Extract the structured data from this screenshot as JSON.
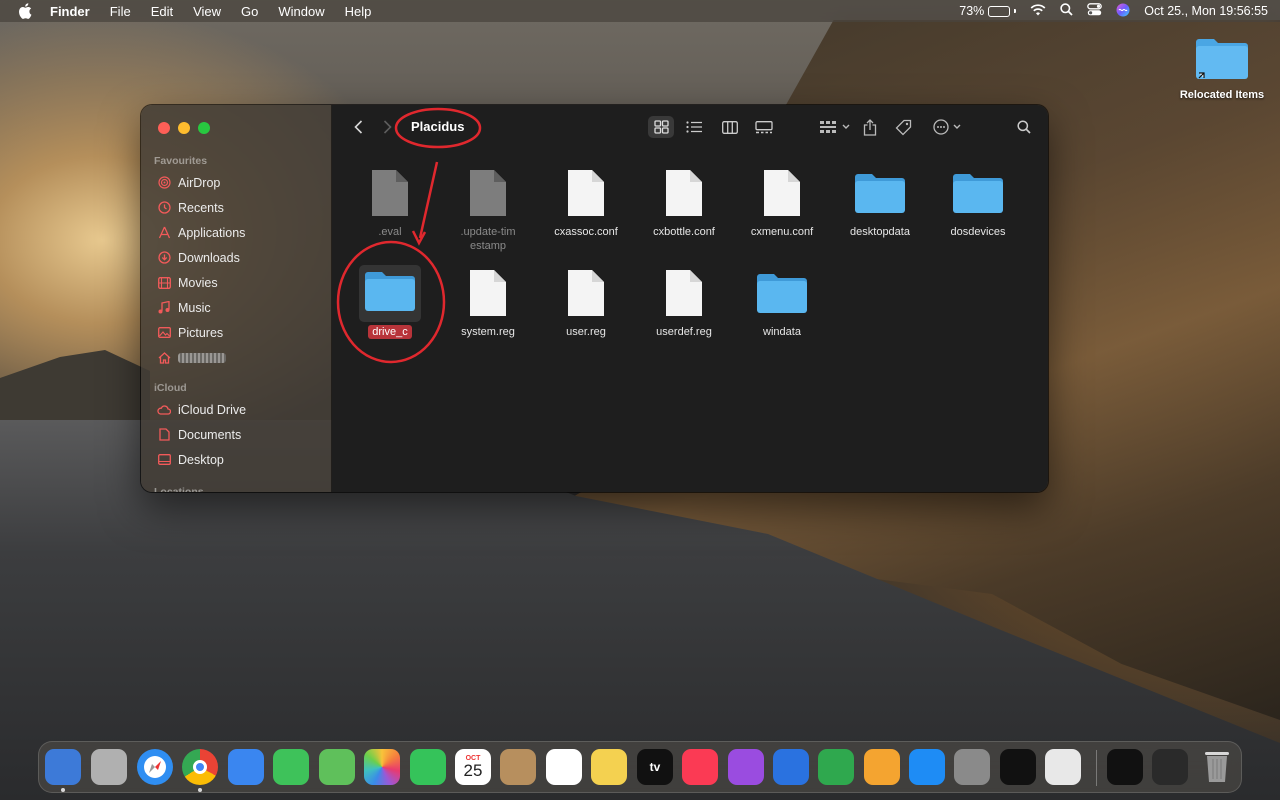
{
  "menubar": {
    "app_name": "Finder",
    "menus": [
      "File",
      "Edit",
      "View",
      "Go",
      "Window",
      "Help"
    ],
    "battery_percent": "73%",
    "battery_level": 0.73,
    "datetime": "Oct 25., Mon  19:56:55"
  },
  "desktop": {
    "items": [
      {
        "label": "Relocated Items",
        "icon": "folder-alias-icon"
      }
    ]
  },
  "window": {
    "title": "Placidus",
    "sidebar": {
      "favourites_heading": "Favourites",
      "favourites": [
        {
          "label": "AirDrop",
          "icon": "airdrop-icon"
        },
        {
          "label": "Recents",
          "icon": "clock-icon"
        },
        {
          "label": "Applications",
          "icon": "applications-icon"
        },
        {
          "label": "Downloads",
          "icon": "download-icon"
        },
        {
          "label": "Movies",
          "icon": "film-icon"
        },
        {
          "label": "Music",
          "icon": "music-note-icon"
        },
        {
          "label": "Pictures",
          "icon": "photo-icon"
        },
        {
          "label": "",
          "icon": "home-icon"
        }
      ],
      "icloud_heading": "iCloud",
      "icloud": [
        {
          "label": "iCloud Drive",
          "icon": "cloud-icon"
        },
        {
          "label": "Documents",
          "icon": "document-icon"
        },
        {
          "label": "Desktop",
          "icon": "desktop-icon"
        }
      ],
      "locations_heading": "Locations"
    },
    "files": [
      {
        "name": ".eval",
        "kind": "file",
        "hidden": true
      },
      {
        "name": ".update-timestamp",
        "kind": "file",
        "hidden": true
      },
      {
        "name": "cxassoc.conf",
        "kind": "file"
      },
      {
        "name": "cxbottle.conf",
        "kind": "file"
      },
      {
        "name": "cxmenu.conf",
        "kind": "file"
      },
      {
        "name": "desktopdata",
        "kind": "folder"
      },
      {
        "name": "dosdevices",
        "kind": "folder"
      },
      {
        "name": "drive_c",
        "kind": "folder",
        "selected": true
      },
      {
        "name": "system.reg",
        "kind": "file"
      },
      {
        "name": "user.reg",
        "kind": "file"
      },
      {
        "name": "userdef.reg",
        "kind": "file"
      },
      {
        "name": "windata",
        "kind": "folder"
      }
    ]
  },
  "dock": {
    "calendar_month": "OCT",
    "calendar_day": "25",
    "tv_label": "tv",
    "apps": [
      "Finder",
      "Launchpad",
      "Safari",
      "Chrome",
      "Mail",
      "Messages",
      "Maps",
      "Photos",
      "FaceTime",
      "Calendar",
      "Contacts",
      "Reminders",
      "Notes",
      "TV",
      "Music",
      "Podcasts",
      "Keynote",
      "Numbers",
      "Pages",
      "App Store",
      "System Preferences",
      "CrossOver",
      "Preview"
    ]
  },
  "colors": {
    "accent_red": "#e0282e",
    "folder_blue": "#5ab7f0",
    "selection_label": "#b8343a"
  }
}
